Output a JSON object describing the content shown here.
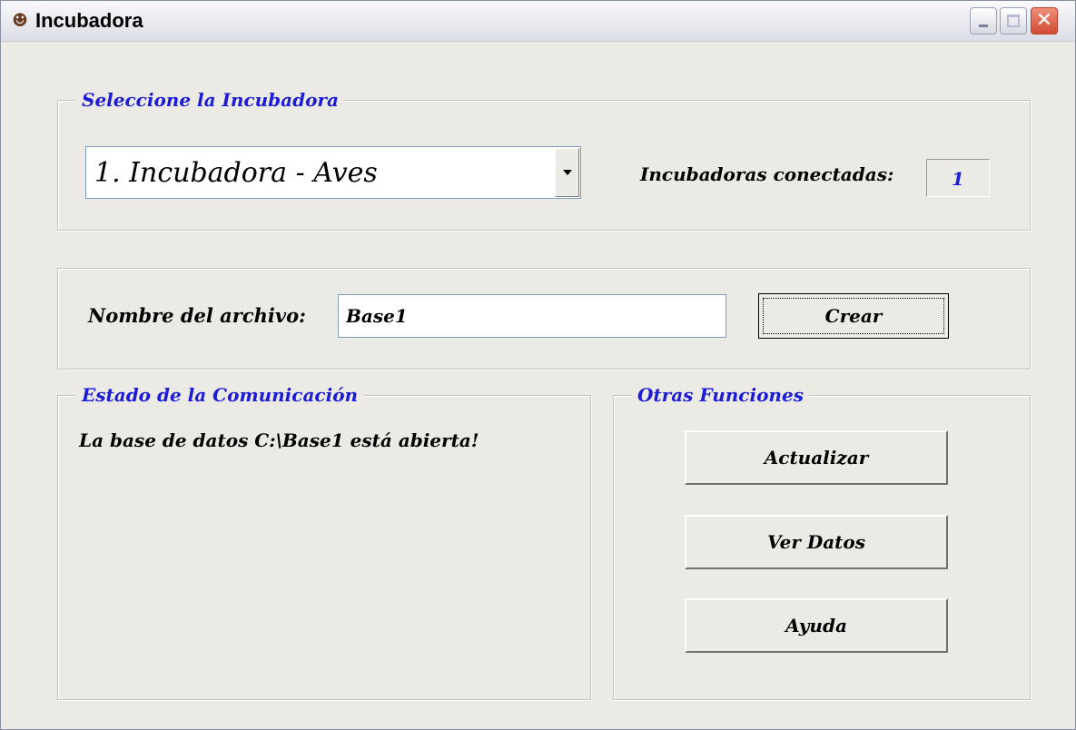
{
  "window": {
    "title": "Incubadora",
    "icon": "incubator-app-icon",
    "close_glyph": "✕"
  },
  "incubator_select": {
    "legend": "Seleccione la Incubadora",
    "selected": "1. Incubadora - Aves",
    "connected_label": "Incubadoras conectadas:",
    "connected_count": "1"
  },
  "file": {
    "label": "Nombre del archivo:",
    "value": "Base1",
    "create_button": "Crear"
  },
  "status": {
    "legend": "Estado de la Comunicación",
    "message": "La base de datos C:\\Base1 está abierta!"
  },
  "other_functions": {
    "legend": "Otras Funciones",
    "update_button": "Actualizar",
    "view_data_button": "Ver Datos",
    "help_button": "Ayuda"
  },
  "colors": {
    "window_bg": "#ebeae5",
    "legend_text": "#1b1bd8",
    "count_text": "#1b1bd8"
  }
}
